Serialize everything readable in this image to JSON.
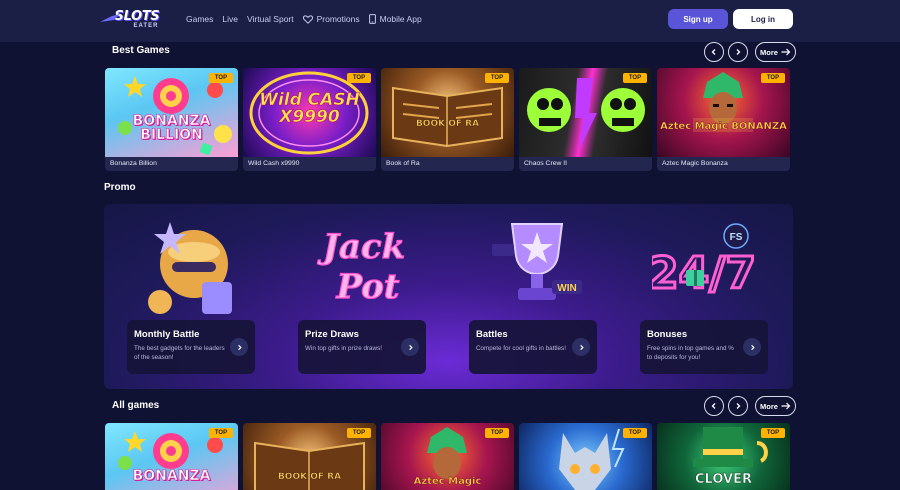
{
  "header": {
    "logo_text": "SLOTS",
    "logo_sub": "EATER",
    "nav": [
      {
        "label": "Games",
        "icon": ""
      },
      {
        "label": "Live",
        "icon": ""
      },
      {
        "label": "Virtual Sport",
        "icon": ""
      },
      {
        "label": "Promotions",
        "icon": "heart-icon"
      },
      {
        "label": "Mobile App",
        "icon": "phone-icon"
      }
    ],
    "signup_label": "Sign up",
    "login_label": "Log in"
  },
  "best_games": {
    "title": "Best Games",
    "more_label": "More",
    "games": [
      {
        "name": "Bonanza Billion",
        "badge": "TOP",
        "art": "BONANZA BILLION",
        "colors": [
          "#6fd9f2",
          "#ff9fd8"
        ]
      },
      {
        "name": "Wild Cash x9990",
        "badge": "TOP",
        "art": "Wild CASH X9990",
        "colors": [
          "#3a0e6e",
          "#ff2fa3"
        ]
      },
      {
        "name": "Book of Ra",
        "badge": "TOP",
        "art": "BOOK OF RA",
        "colors": [
          "#3c1f0c",
          "#c98b3a"
        ]
      },
      {
        "name": "Chaos Crew II",
        "badge": "TOP",
        "art": "",
        "colors": [
          "#0a0a0a",
          "#b6ff2e"
        ]
      },
      {
        "name": "Aztec Magic Bonanza",
        "badge": "TOP",
        "art": "Aztec Magic BONANZA",
        "colors": [
          "#5a0b3c",
          "#ff5a3c"
        ]
      }
    ]
  },
  "promo": {
    "title": "Promo",
    "cards": [
      {
        "title": "Monthly Battle",
        "desc": "The best gadgets for the leaders of the season!"
      },
      {
        "title": "Prize Draws",
        "desc": "Win top gifts in prize draws!"
      },
      {
        "title": "Battles",
        "desc": "Compete for cool gifts in battles!"
      },
      {
        "title": "Bonuses",
        "desc": "Free spins in top games and % to deposits for you!"
      }
    ],
    "art_labels": {
      "jackpot_1": "Jack",
      "jackpot_2": "Pot",
      "win": "WIN",
      "fs": "FS",
      "clock": "24/7"
    }
  },
  "all_games": {
    "title": "All games",
    "more_label": "More",
    "games": [
      {
        "badge": "TOP",
        "art": "BONANZA",
        "colors": [
          "#6fd9f2",
          "#ff9fd8"
        ]
      },
      {
        "badge": "TOP",
        "art": "BOOK OF RA",
        "colors": [
          "#3c1f0c",
          "#c98b3a"
        ]
      },
      {
        "badge": "TOP",
        "art": "Aztec Magic",
        "colors": [
          "#5a0b3c",
          "#ff5a3c"
        ]
      },
      {
        "badge": "TOP",
        "art": "",
        "colors": [
          "#0b2a66",
          "#55b8ff"
        ]
      },
      {
        "badge": "TOP",
        "art": "CLOVER",
        "colors": [
          "#07311f",
          "#2fb86a"
        ]
      }
    ]
  },
  "colors": {
    "background": "#0f1232",
    "header": "#1b1f46",
    "accent": "#5a55d8",
    "badge": "#ffb300"
  }
}
